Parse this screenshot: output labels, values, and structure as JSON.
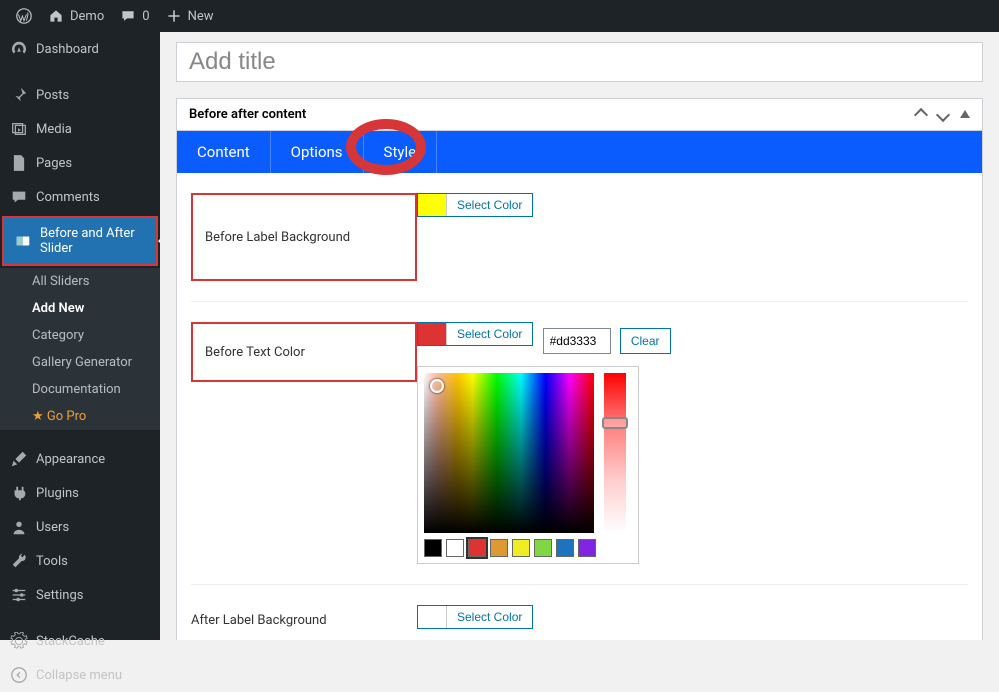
{
  "adminbar": {
    "site_name": "Demo",
    "comments_count": "0",
    "new_label": "New"
  },
  "sidebar": {
    "dashboard": "Dashboard",
    "posts": "Posts",
    "media": "Media",
    "pages": "Pages",
    "comments": "Comments",
    "bas": "Before and After Slider",
    "bas_submenu": {
      "all": "All Sliders",
      "addnew": "Add New",
      "category": "Category",
      "gallery": "Gallery Generator",
      "docs": "Documentation",
      "gopro": "Go Pro"
    },
    "appearance": "Appearance",
    "plugins": "Plugins",
    "users": "Users",
    "tools": "Tools",
    "settings": "Settings",
    "stackcache": "StackCache",
    "collapse": "Collapse menu"
  },
  "editor": {
    "title_placeholder": "Add title",
    "metabox_title": "Before after content",
    "tabs": {
      "content": "Content",
      "options": "Options",
      "style": "Style"
    },
    "style": {
      "before_label_bg": "Before Label Background",
      "before_text_color": "Before Text Color",
      "after_label_bg": "After Label Background",
      "select_color": "Select Color",
      "clear": "Clear",
      "hex_value": "#dd3333",
      "swatch_before_bg": "#ffff00",
      "swatch_before_text": "#dd3333",
      "presets": [
        "#000000",
        "#ffffff",
        "#dd3333",
        "#dd9933",
        "#eeee22",
        "#81d742",
        "#1e73be",
        "#8224e3"
      ]
    }
  }
}
